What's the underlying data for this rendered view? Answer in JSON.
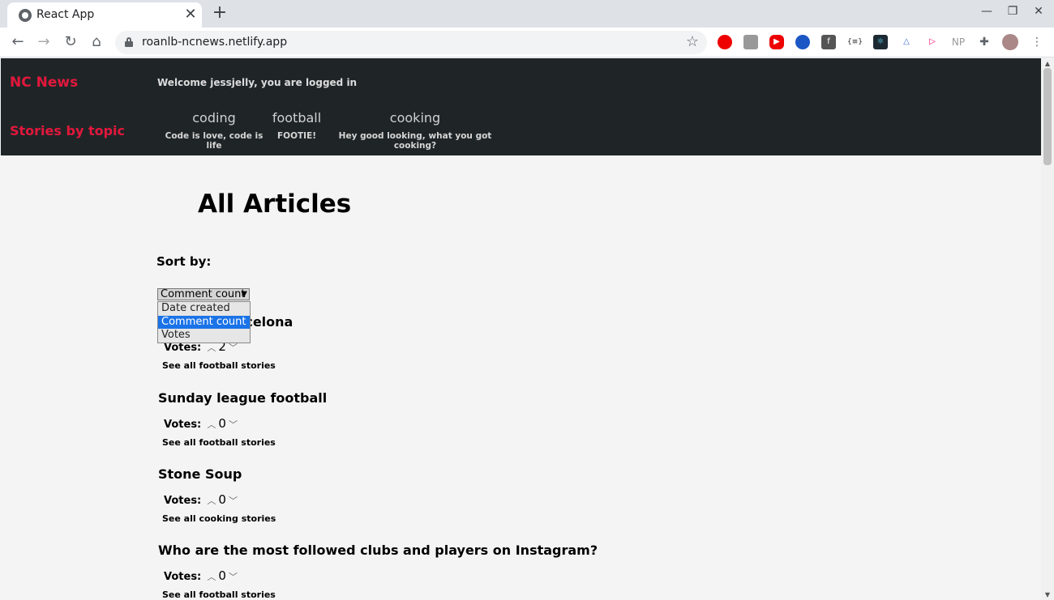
{
  "browser": {
    "tab_title": "React App",
    "url": "roanlb-ncnews.netlify.app",
    "extension_np": "NP"
  },
  "header": {
    "brand": "NC News",
    "stories_by_topic": "Stories by topic",
    "welcome": "Welcome jessjelly, you are logged in",
    "topics": [
      {
        "name": "coding",
        "desc": "Code is love, code is life"
      },
      {
        "name": "football",
        "desc": "FOOTIE!"
      },
      {
        "name": "cooking",
        "desc": "Hey good looking, what you got cooking?"
      }
    ]
  },
  "main": {
    "title": "All Articles",
    "sort_label": "Sort by:",
    "sort_selected": "Comment count",
    "sort_options": [
      "Date created",
      "Comment count",
      "Votes"
    ],
    "votes_label": "Votes:",
    "articles": [
      {
        "title": "Barcelona",
        "title_visible": "arcelona",
        "votes": "2",
        "see_all": "See all football stories"
      },
      {
        "title": "Sunday league football",
        "votes": "0",
        "see_all": "See all football stories"
      },
      {
        "title": "Stone Soup",
        "votes": "0",
        "see_all": "See all cooking stories"
      },
      {
        "title": "Who are the most followed clubs and players on Instagram?",
        "votes": "0",
        "see_all": "See all football stories"
      }
    ]
  }
}
